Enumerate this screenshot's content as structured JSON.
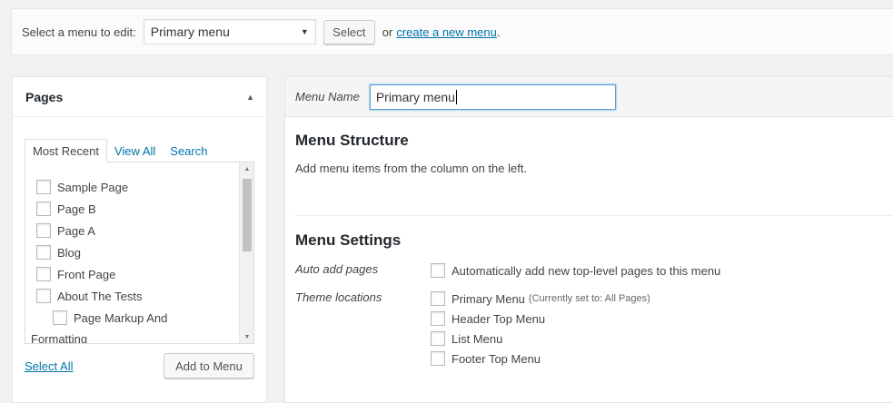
{
  "manage": {
    "label": "Select a menu to edit:",
    "selected_menu": "Primary menu",
    "select_button": "Select",
    "or_text": "or",
    "create_link": "create a new menu",
    "create_suffix": "."
  },
  "pages_box": {
    "title": "Pages",
    "tabs": [
      "Most Recent",
      "View All",
      "Search"
    ],
    "items": [
      "Sample Page",
      "Page B",
      "Page A",
      "Blog",
      "Front Page",
      "About The Tests",
      "Page Markup And",
      "Formatting"
    ],
    "select_all": "Select All",
    "add_button": "Add to Menu"
  },
  "editor": {
    "menu_name_label": "Menu Name",
    "menu_name_value": "Primary menu",
    "structure_title": "Menu Structure",
    "structure_desc": "Add menu items from the column on the left.",
    "settings_title": "Menu Settings",
    "auto_add_label": "Auto add pages",
    "auto_add_option": "Automatically add new top-level pages to this menu",
    "theme_locations_label": "Theme locations",
    "locations": [
      {
        "label": "Primary Menu",
        "note": "(Currently set to: All Pages)"
      },
      {
        "label": "Header Top Menu",
        "note": ""
      },
      {
        "label": "List Menu",
        "note": ""
      },
      {
        "label": "Footer Top Menu",
        "note": ""
      }
    ]
  },
  "colors": {
    "link": "#0073aa",
    "focus": "#5b9dd9",
    "background": "#f1f1f1"
  }
}
